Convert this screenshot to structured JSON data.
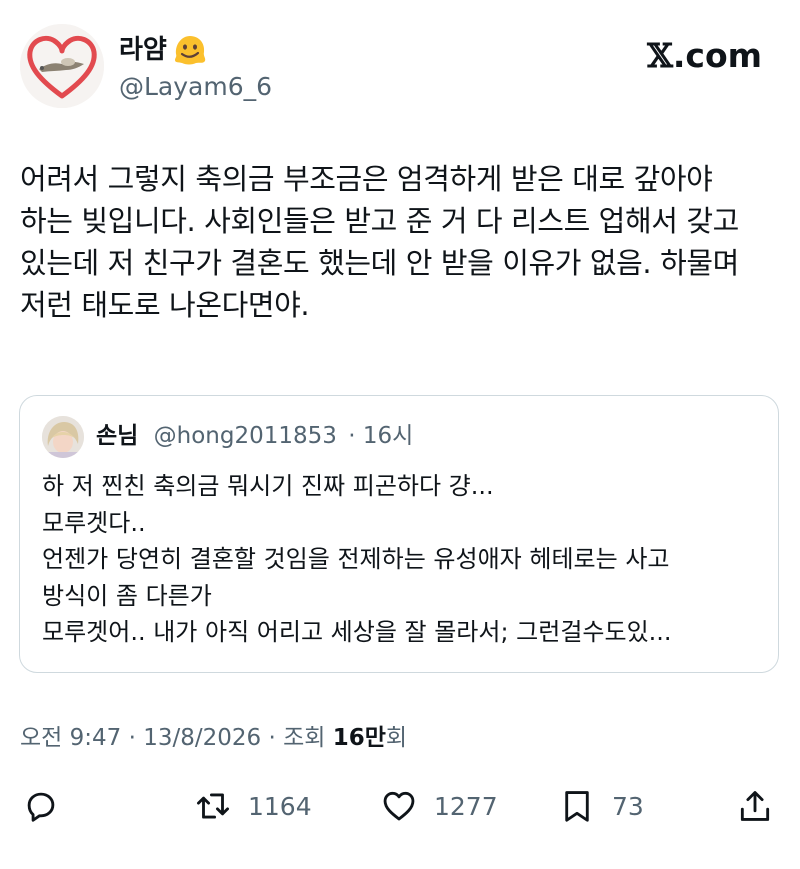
{
  "author": {
    "display_name": "라얌",
    "handle": "@Layam6_6",
    "avatar_icon": "heart-avatar-icon",
    "name_emoji_icon": "melting-face-emoji-icon"
  },
  "brand": {
    "logo_x": "𝕏",
    "logo_suffix": ".com"
  },
  "tweet": {
    "lines": [
      "어려서 그렇지 축의금 부조금은 엄격하게 받은 대로 갚아야",
      "하는 빚입니다. 사회인들은 받고 준 거 다 리스트 업해서 갖고",
      "있는데 저 친구가 결혼도 했는데 안 받을 이유가 없음. 하물며",
      "저런 태도로 나온다면야."
    ]
  },
  "quote": {
    "name": "손님",
    "handle": "@hong2011853",
    "time": "· 16시",
    "lines": [
      "하 저 찐친 축의금 뭐시기 진짜 피곤하다 걍...",
      "모루겟다..",
      "언젠가 당연히 결혼할 것임을 전제하는 유성애자 헤테로는 사고",
      "방식이 좀 다른가",
      "모루겟어.. 내가 아직 어리고 세상을 잘 몰라서; 그런걸수도있..."
    ]
  },
  "meta": {
    "time": "오전 9:47",
    "date": "· 13/8/2026 ·",
    "views_label": "조회",
    "views_num": "16만",
    "views_unit": "회"
  },
  "actions": {
    "reply_icon": "reply-icon",
    "retweet_icon": "retweet-icon",
    "retweet_count": "1164",
    "like_icon": "heart-icon",
    "like_count": "1277",
    "bookmark_icon": "bookmark-icon",
    "bookmark_count": "73",
    "share_icon": "share-icon"
  },
  "colors": {
    "text": "#0f1419",
    "secondary": "#536471",
    "border": "#cfd9de",
    "heart_red": "#e0454b"
  }
}
